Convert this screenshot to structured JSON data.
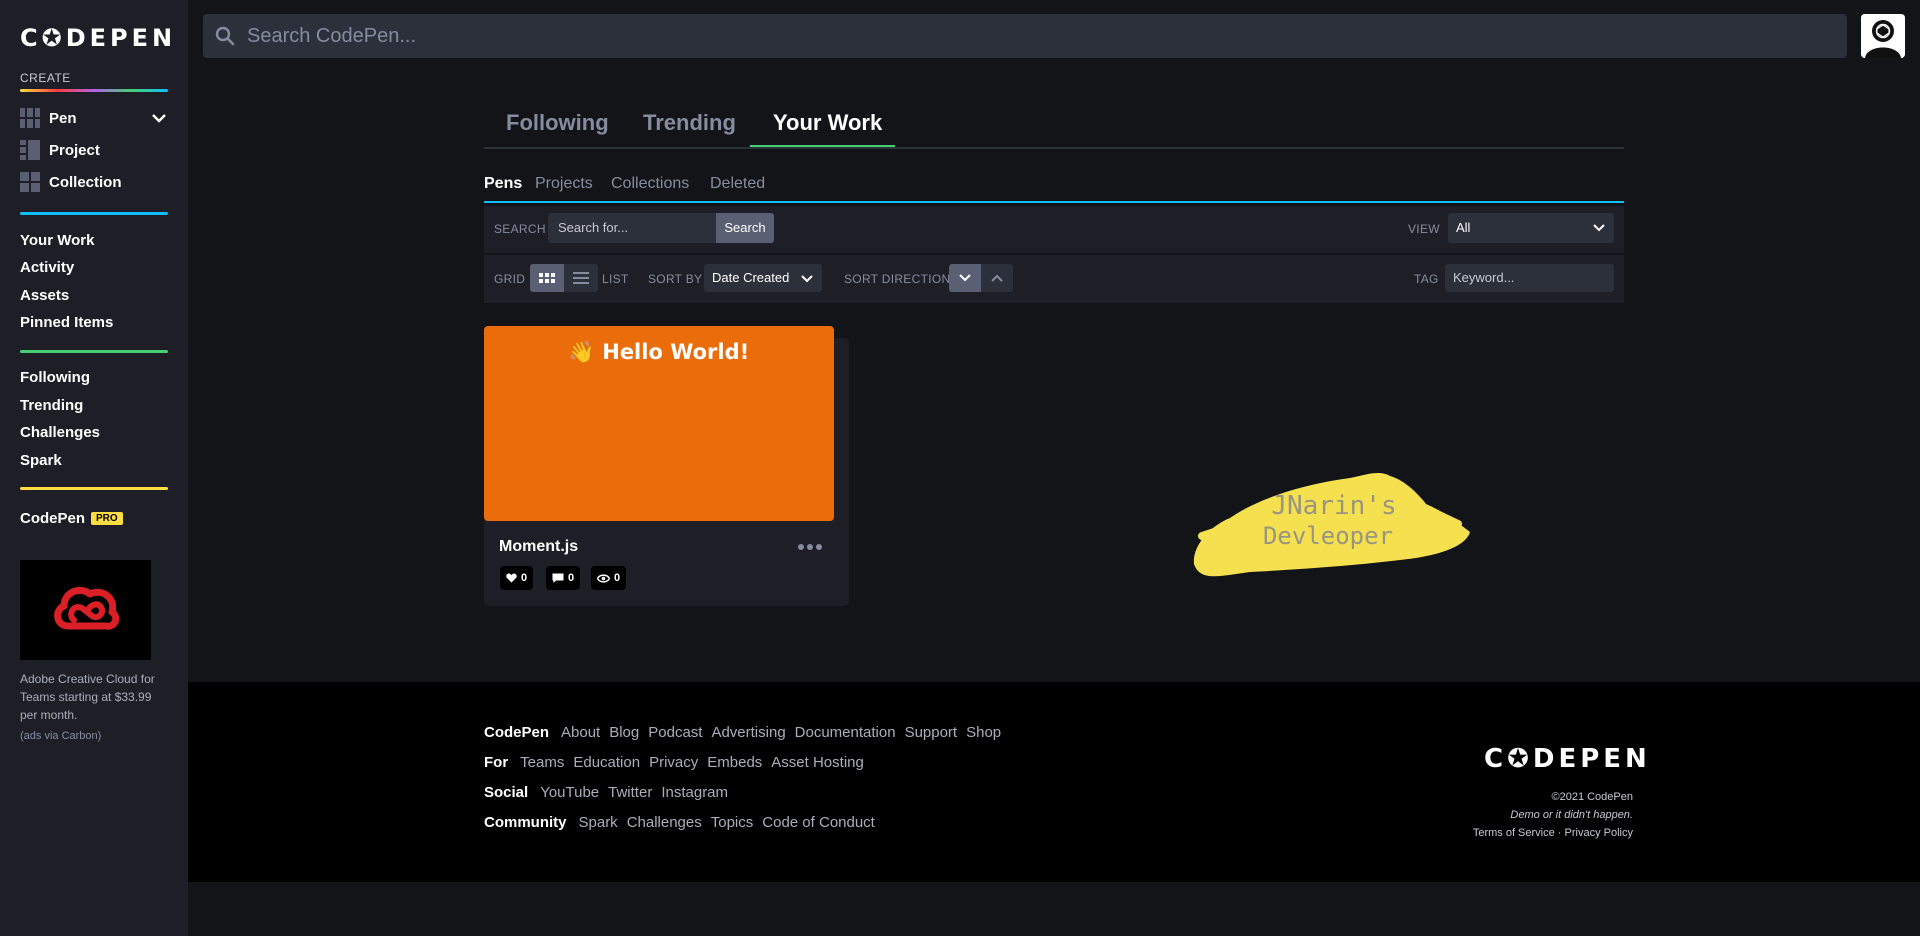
{
  "sidebar": {
    "logo": "C✪DEPEN",
    "create_label": "CREATE",
    "create_items": [
      {
        "label": "Pen"
      },
      {
        "label": "Project"
      },
      {
        "label": "Collection"
      }
    ],
    "nav_group1": [
      {
        "label": "Your Work"
      },
      {
        "label": "Activity"
      },
      {
        "label": "Assets"
      },
      {
        "label": "Pinned Items"
      }
    ],
    "nav_group2": [
      {
        "label": "Following"
      },
      {
        "label": "Trending"
      },
      {
        "label": "Challenges"
      },
      {
        "label": "Spark"
      }
    ],
    "pro_label": "CodePen",
    "pro_badge": "PRO",
    "ad_text": "Adobe Creative Cloud for Teams starting at $33.99 per month.",
    "ad_via": "(ads via Carbon)"
  },
  "topbar": {
    "search_placeholder": "Search CodePen..."
  },
  "main_tabs": [
    {
      "label": "Following",
      "active": false
    },
    {
      "label": "Trending",
      "active": false
    },
    {
      "label": "Your Work",
      "active": true
    }
  ],
  "sub_tabs": [
    {
      "label": "Pens",
      "active": true
    },
    {
      "label": "Projects",
      "active": false
    },
    {
      "label": "Collections",
      "active": false
    },
    {
      "label": "Deleted",
      "active": false
    }
  ],
  "filters": {
    "search_label": "SEARCH",
    "search_placeholder": "Search for...",
    "search_button": "Search",
    "view_label": "VIEW",
    "view_value": "All",
    "grid_label": "GRID",
    "list_label": "LIST",
    "sortby_label": "SORT BY",
    "sortby_value": "Date Created",
    "sortdir_label": "SORT DIRECTION",
    "tag_label": "TAG",
    "tag_placeholder": "Keyword..."
  },
  "pen": {
    "preview_text": "👋 Hello World!",
    "title": "Moment.js",
    "likes": "0",
    "comments": "0",
    "views": "0",
    "preview_color": "#ea6c0a"
  },
  "splash": {
    "line1": "JNarin's",
    "line2": "Devleoper"
  },
  "footer": {
    "rows": [
      {
        "heading": "CodePen",
        "links": [
          "About",
          "Blog",
          "Podcast",
          "Advertising",
          "Documentation",
          "Support",
          "Shop"
        ]
      },
      {
        "heading": "For",
        "links": [
          "Teams",
          "Education",
          "Privacy",
          "Embeds",
          "Asset Hosting"
        ]
      },
      {
        "heading": "Social",
        "links": [
          "YouTube",
          "Twitter",
          "Instagram"
        ]
      },
      {
        "heading": "Community",
        "links": [
          "Spark",
          "Challenges",
          "Topics",
          "Code of Conduct"
        ]
      }
    ],
    "logo": "C✪DEPEN",
    "copyright": "©2021 CodePen",
    "tagline": "Demo or it didn't happen.",
    "terms": "Terms of Service",
    "sep": " · ",
    "privacy": "Privacy Policy"
  },
  "colors": {
    "accent_green": "#47cf73",
    "accent_blue": "#0ebeff",
    "accent_yellow": "#ffdd40"
  }
}
